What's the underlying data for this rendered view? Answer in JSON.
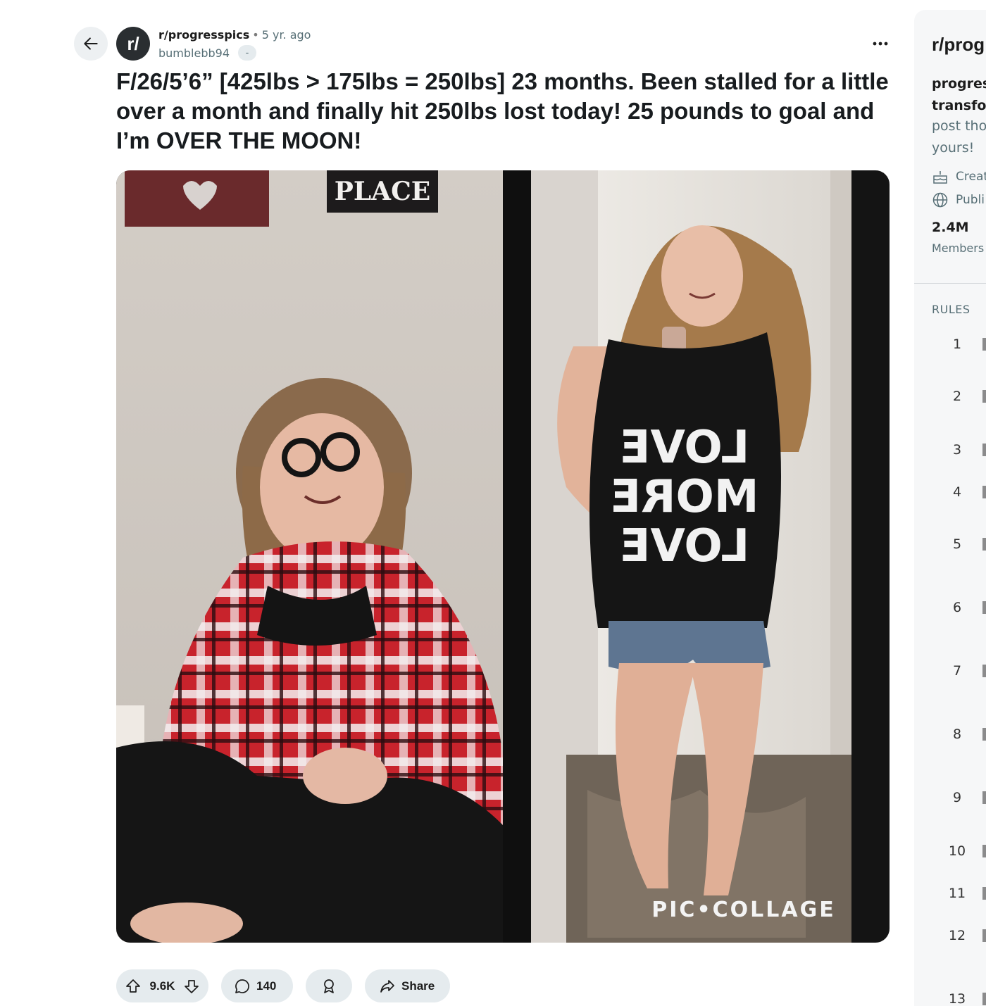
{
  "post": {
    "subreddit": "r/progresspics",
    "separator": "•",
    "time": "5 yr. ago",
    "author": "bumblebb94",
    "flair": "-",
    "title": "F/26/5’6” [425lbs > 175lbs = 250lbs] 23 months. Been stalled for a little over a month and finally hit 250lbs lost today! 25 pounds to goal and I’m OVER THE MOON!",
    "avatar_text": "r/",
    "image_texts": {
      "sign": "PLACE",
      "shirt_line1": "LOVE",
      "shirt_line2": "MORE",
      "shirt_line3": "LOVE",
      "watermark": "PIC•COLLAGE"
    }
  },
  "actions": {
    "votes": "9.6K",
    "comments": "140",
    "share": "Share"
  },
  "sidebar": {
    "title": "r/prog",
    "desc_line1": "progress",
    "desc_line2": "transfor",
    "desc_line3": "post tho",
    "desc_line4": "yours!",
    "created": "Creat",
    "public": "Publi",
    "members_count": "2.4M",
    "members_label": "Members",
    "rules_label": "RULES",
    "rules": [
      "1",
      "2",
      "3",
      "4",
      "5",
      "6",
      "7",
      "8",
      "9",
      "10",
      "11",
      "12",
      "13"
    ]
  },
  "colors": {
    "accent_bg": "#e5ebee",
    "text_primary": "#1c1c1c",
    "text_secondary": "#576f76",
    "sidebar_bg": "#f6f7f8"
  }
}
